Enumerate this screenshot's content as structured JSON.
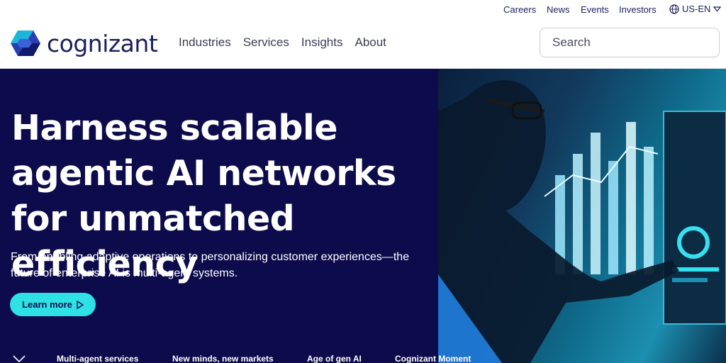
{
  "utility": {
    "careers": "Careers",
    "news": "News",
    "events": "Events",
    "investors": "Investors",
    "language": "US-EN",
    "globe_icon": "globe-icon",
    "caret_icon": "caret-down-icon"
  },
  "brand": {
    "name": "cognizant",
    "color": "#1b1f5c",
    "logo_colors": [
      "#2a3eb1",
      "#1cb6d8",
      "#0f1a6b"
    ]
  },
  "nav": {
    "items": [
      "Industries",
      "Services",
      "Insights",
      "About"
    ]
  },
  "search": {
    "placeholder": "Search",
    "icon": "search-icon"
  },
  "hero": {
    "title": "Harness scalable agentic AI networks for unmatched efficiency",
    "subtitle": "From enabling adaptive operations to personalizing customer experiences—the future of enterprise AI is multi-agent systems.",
    "cta": "Learn more",
    "cta_icon": "play-triangle-icon",
    "background": "#0d0b4c",
    "accent": "#2ee1e4"
  },
  "bottom_links": [
    "Multi-agent services",
    "New minds, new markets",
    "Age of gen AI",
    "Cognizant Moment"
  ]
}
